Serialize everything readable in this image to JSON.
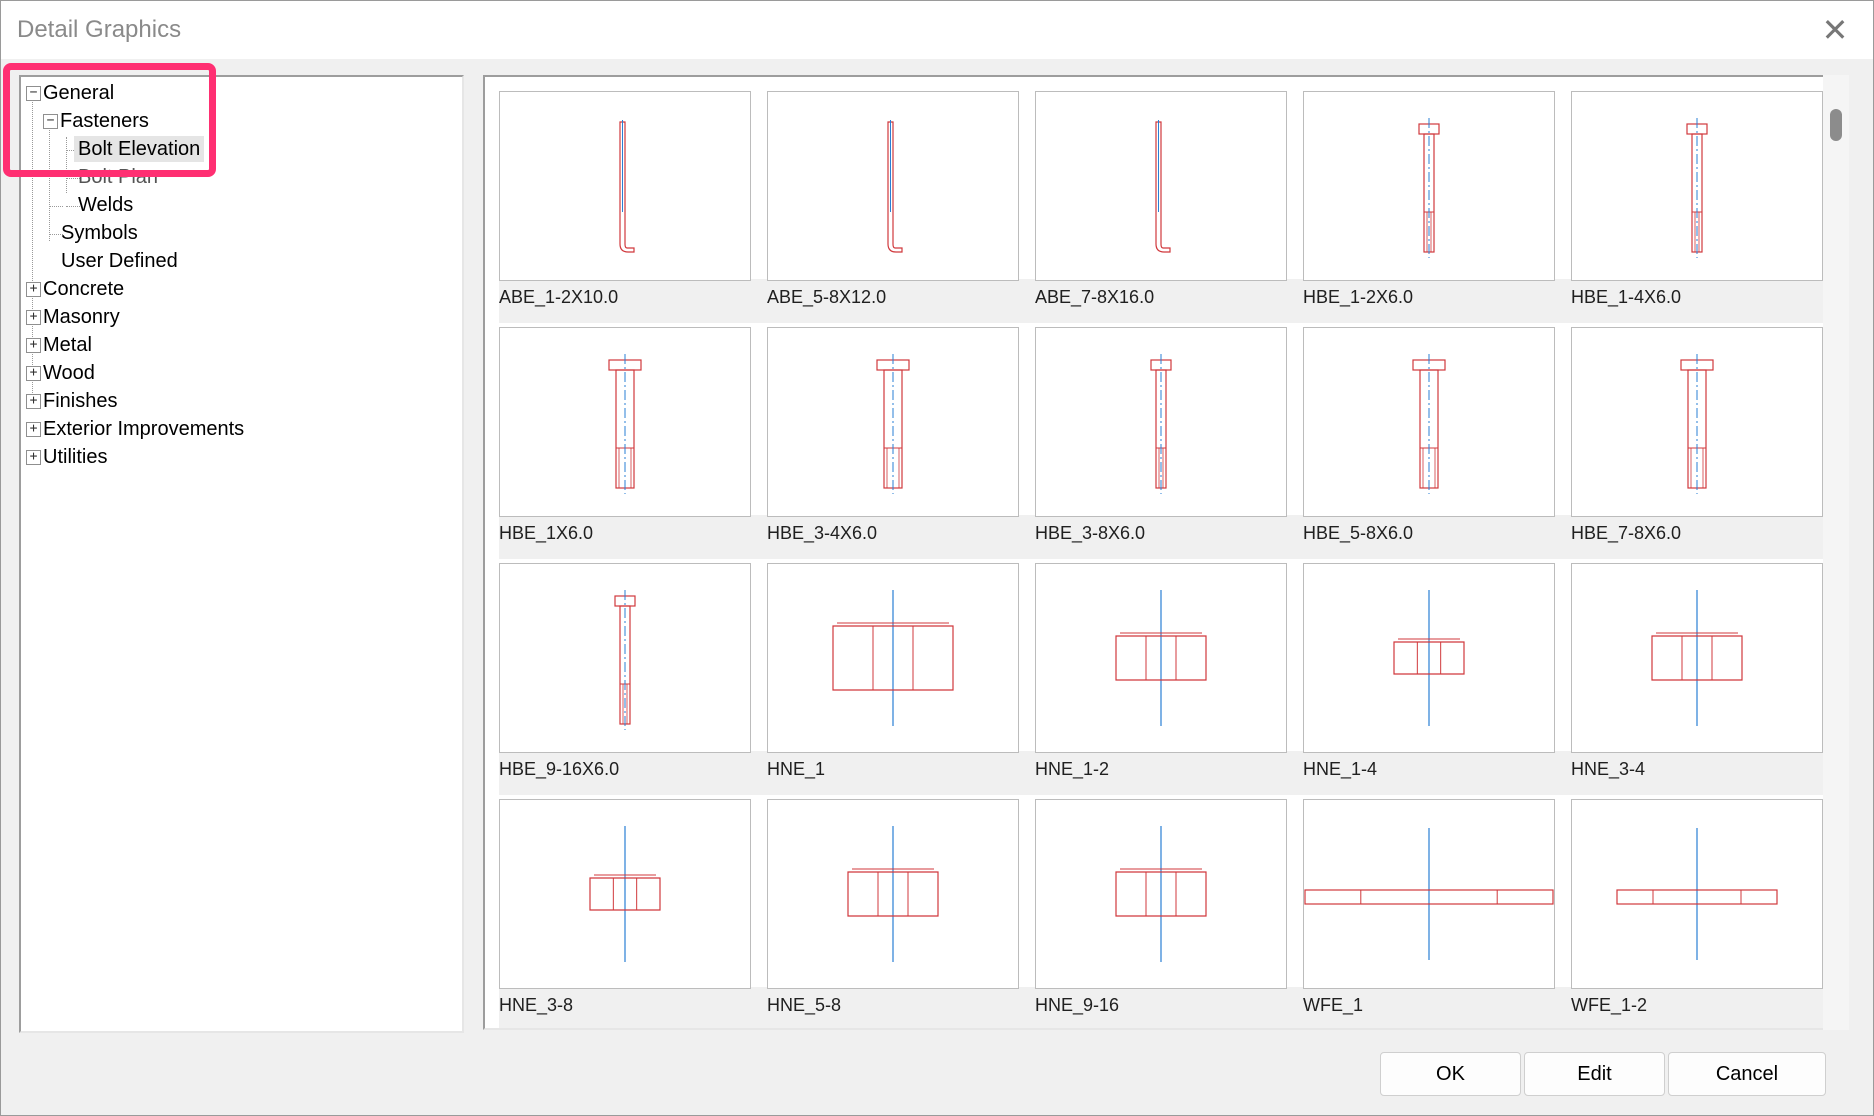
{
  "window": {
    "title": "Detail Graphics",
    "close_glyph": "✕"
  },
  "tree": {
    "general": "General",
    "fasteners": "Fasteners",
    "bolt_elevation": "Bolt Elevation",
    "bolt_plan": "Bolt Plan",
    "welds": "Welds",
    "symbols": "Symbols",
    "user_defined": "User Defined",
    "concrete": "Concrete",
    "masonry": "Masonry",
    "metal": "Metal",
    "wood": "Wood",
    "finishes": "Finishes",
    "exterior": "Exterior Improvements",
    "utilities": "Utilities",
    "expanded_glyph": "−",
    "collapsed_glyph": "+"
  },
  "gallery": {
    "items": [
      {
        "label": "ABE_1-2X10.0",
        "kind": "abe"
      },
      {
        "label": "ABE_5-8X12.0",
        "kind": "abe"
      },
      {
        "label": "ABE_7-8X16.0",
        "kind": "abe"
      },
      {
        "label": "HBE_1-2X6.0",
        "kind": "hbe-thin"
      },
      {
        "label": "HBE_1-4X6.0",
        "kind": "hbe-thin"
      },
      {
        "label": "HBE_1X6.0",
        "kind": "hbe"
      },
      {
        "label": "HBE_3-4X6.0",
        "kind": "hbe"
      },
      {
        "label": "HBE_3-8X6.0",
        "kind": "hbe-thin"
      },
      {
        "label": "HBE_5-8X6.0",
        "kind": "hbe"
      },
      {
        "label": "HBE_7-8X6.0",
        "kind": "hbe"
      },
      {
        "label": "HBE_9-16X6.0",
        "kind": "hbe-thin"
      },
      {
        "label": "HNE_1",
        "kind": "hne-large"
      },
      {
        "label": "HNE_1-2",
        "kind": "hne"
      },
      {
        "label": "HNE_1-4",
        "kind": "hne-small"
      },
      {
        "label": "HNE_3-4",
        "kind": "hne"
      },
      {
        "label": "HNE_3-8",
        "kind": "hne-small"
      },
      {
        "label": "HNE_5-8",
        "kind": "hne"
      },
      {
        "label": "HNE_9-16",
        "kind": "hne"
      },
      {
        "label": "WFE_1",
        "kind": "wfe-wide"
      },
      {
        "label": "WFE_1-2",
        "kind": "wfe"
      }
    ]
  },
  "buttons": {
    "ok": "OK",
    "edit": "Edit",
    "cancel": "Cancel"
  },
  "colors": {
    "drawing_red": "#d0383c",
    "axis_blue": "#2a7fd4",
    "highlight": "#ff2f72"
  }
}
